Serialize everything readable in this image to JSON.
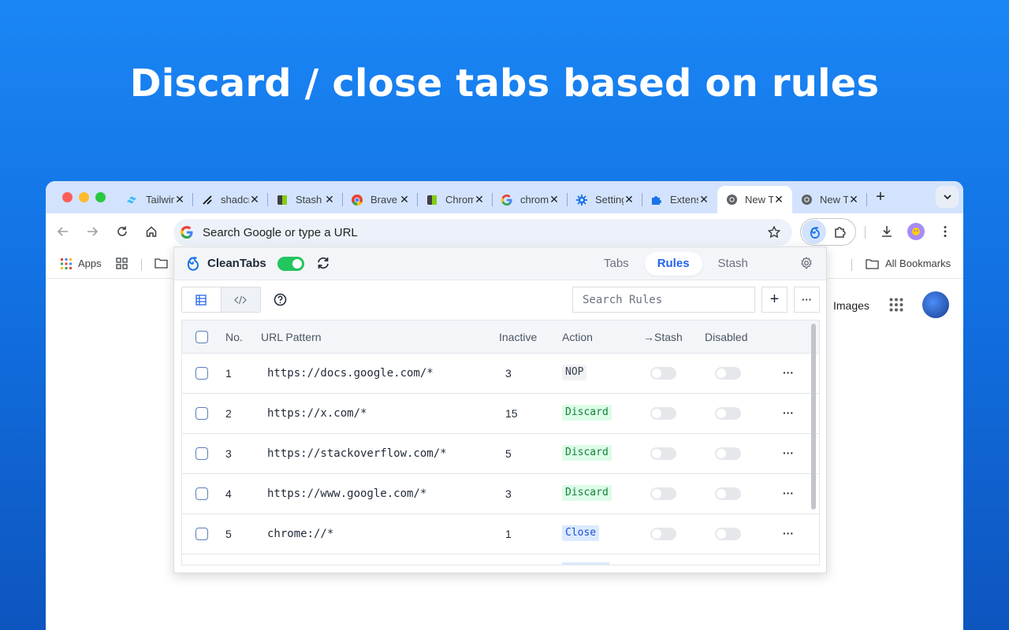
{
  "headline": "Discard / close tabs based on rules",
  "browser": {
    "tabs": [
      {
        "title": "Tailwind",
        "favicon": "tailwind-icon",
        "color": "#38bdf8"
      },
      {
        "title": "shadcn",
        "favicon": "shadcn-icon",
        "color": "#111111"
      },
      {
        "title": "Stash",
        "favicon": "stash-icon",
        "color": "#84cc16"
      },
      {
        "title": "Brave",
        "favicon": "chrome-icon",
        "color": "#ea4335"
      },
      {
        "title": "Chrome",
        "favicon": "chrome-web-icon",
        "color": "#84cc16"
      },
      {
        "title": "chrome",
        "favicon": "google-icon",
        "color": "#4285f4"
      },
      {
        "title": "Settings",
        "favicon": "gear-icon",
        "color": "#1a73e8"
      },
      {
        "title": "Extensions",
        "favicon": "puzzle-icon",
        "color": "#1a73e8"
      },
      {
        "title": "New Tab",
        "favicon": "chrome-logo-icon",
        "color": "#5f6368",
        "active": true
      },
      {
        "title": "New Tab",
        "favicon": "chrome-logo-icon",
        "color": "#5f6368"
      }
    ],
    "tab_close": "✕",
    "new_tab": "+",
    "omnibox_placeholder": "Search Google or type a URL",
    "bookmarks": {
      "apps": "Apps",
      "all_bookmarks": "All Bookmarks"
    },
    "page_images_link": "Images"
  },
  "popup": {
    "brand": "CleanTabs",
    "nav": [
      {
        "label": "Tabs",
        "active": false
      },
      {
        "label": "Rules",
        "active": true
      },
      {
        "label": "Stash",
        "active": false
      }
    ],
    "search_placeholder": "Search Rules",
    "add_button": "+",
    "more_button": "···",
    "columns": {
      "no": "No.",
      "url_pattern": "URL Pattern",
      "inactive": "Inactive",
      "action": "Action",
      "stash": "→Stash",
      "disabled": "Disabled"
    },
    "rules": [
      {
        "no": "1",
        "url": "https://docs.google.com/*",
        "inactive": "3",
        "action": "NOP",
        "kind": "nop"
      },
      {
        "no": "2",
        "url": "https://x.com/*",
        "inactive": "15",
        "action": "Discard",
        "kind": "discard"
      },
      {
        "no": "3",
        "url": "https://stackoverflow.com/*",
        "inactive": "5",
        "action": "Discard",
        "kind": "discard"
      },
      {
        "no": "4",
        "url": "https://www.google.com/*",
        "inactive": "3",
        "action": "Discard",
        "kind": "discard"
      },
      {
        "no": "5",
        "url": "chrome://*",
        "inactive": "1",
        "action": "Close",
        "kind": "close"
      }
    ],
    "row_menu": "···",
    "colors": {
      "accent": "#2563eb",
      "toggle_on": "#22c55e",
      "discard_bg": "#dcfce7",
      "close_bg": "#dbeafe"
    }
  }
}
